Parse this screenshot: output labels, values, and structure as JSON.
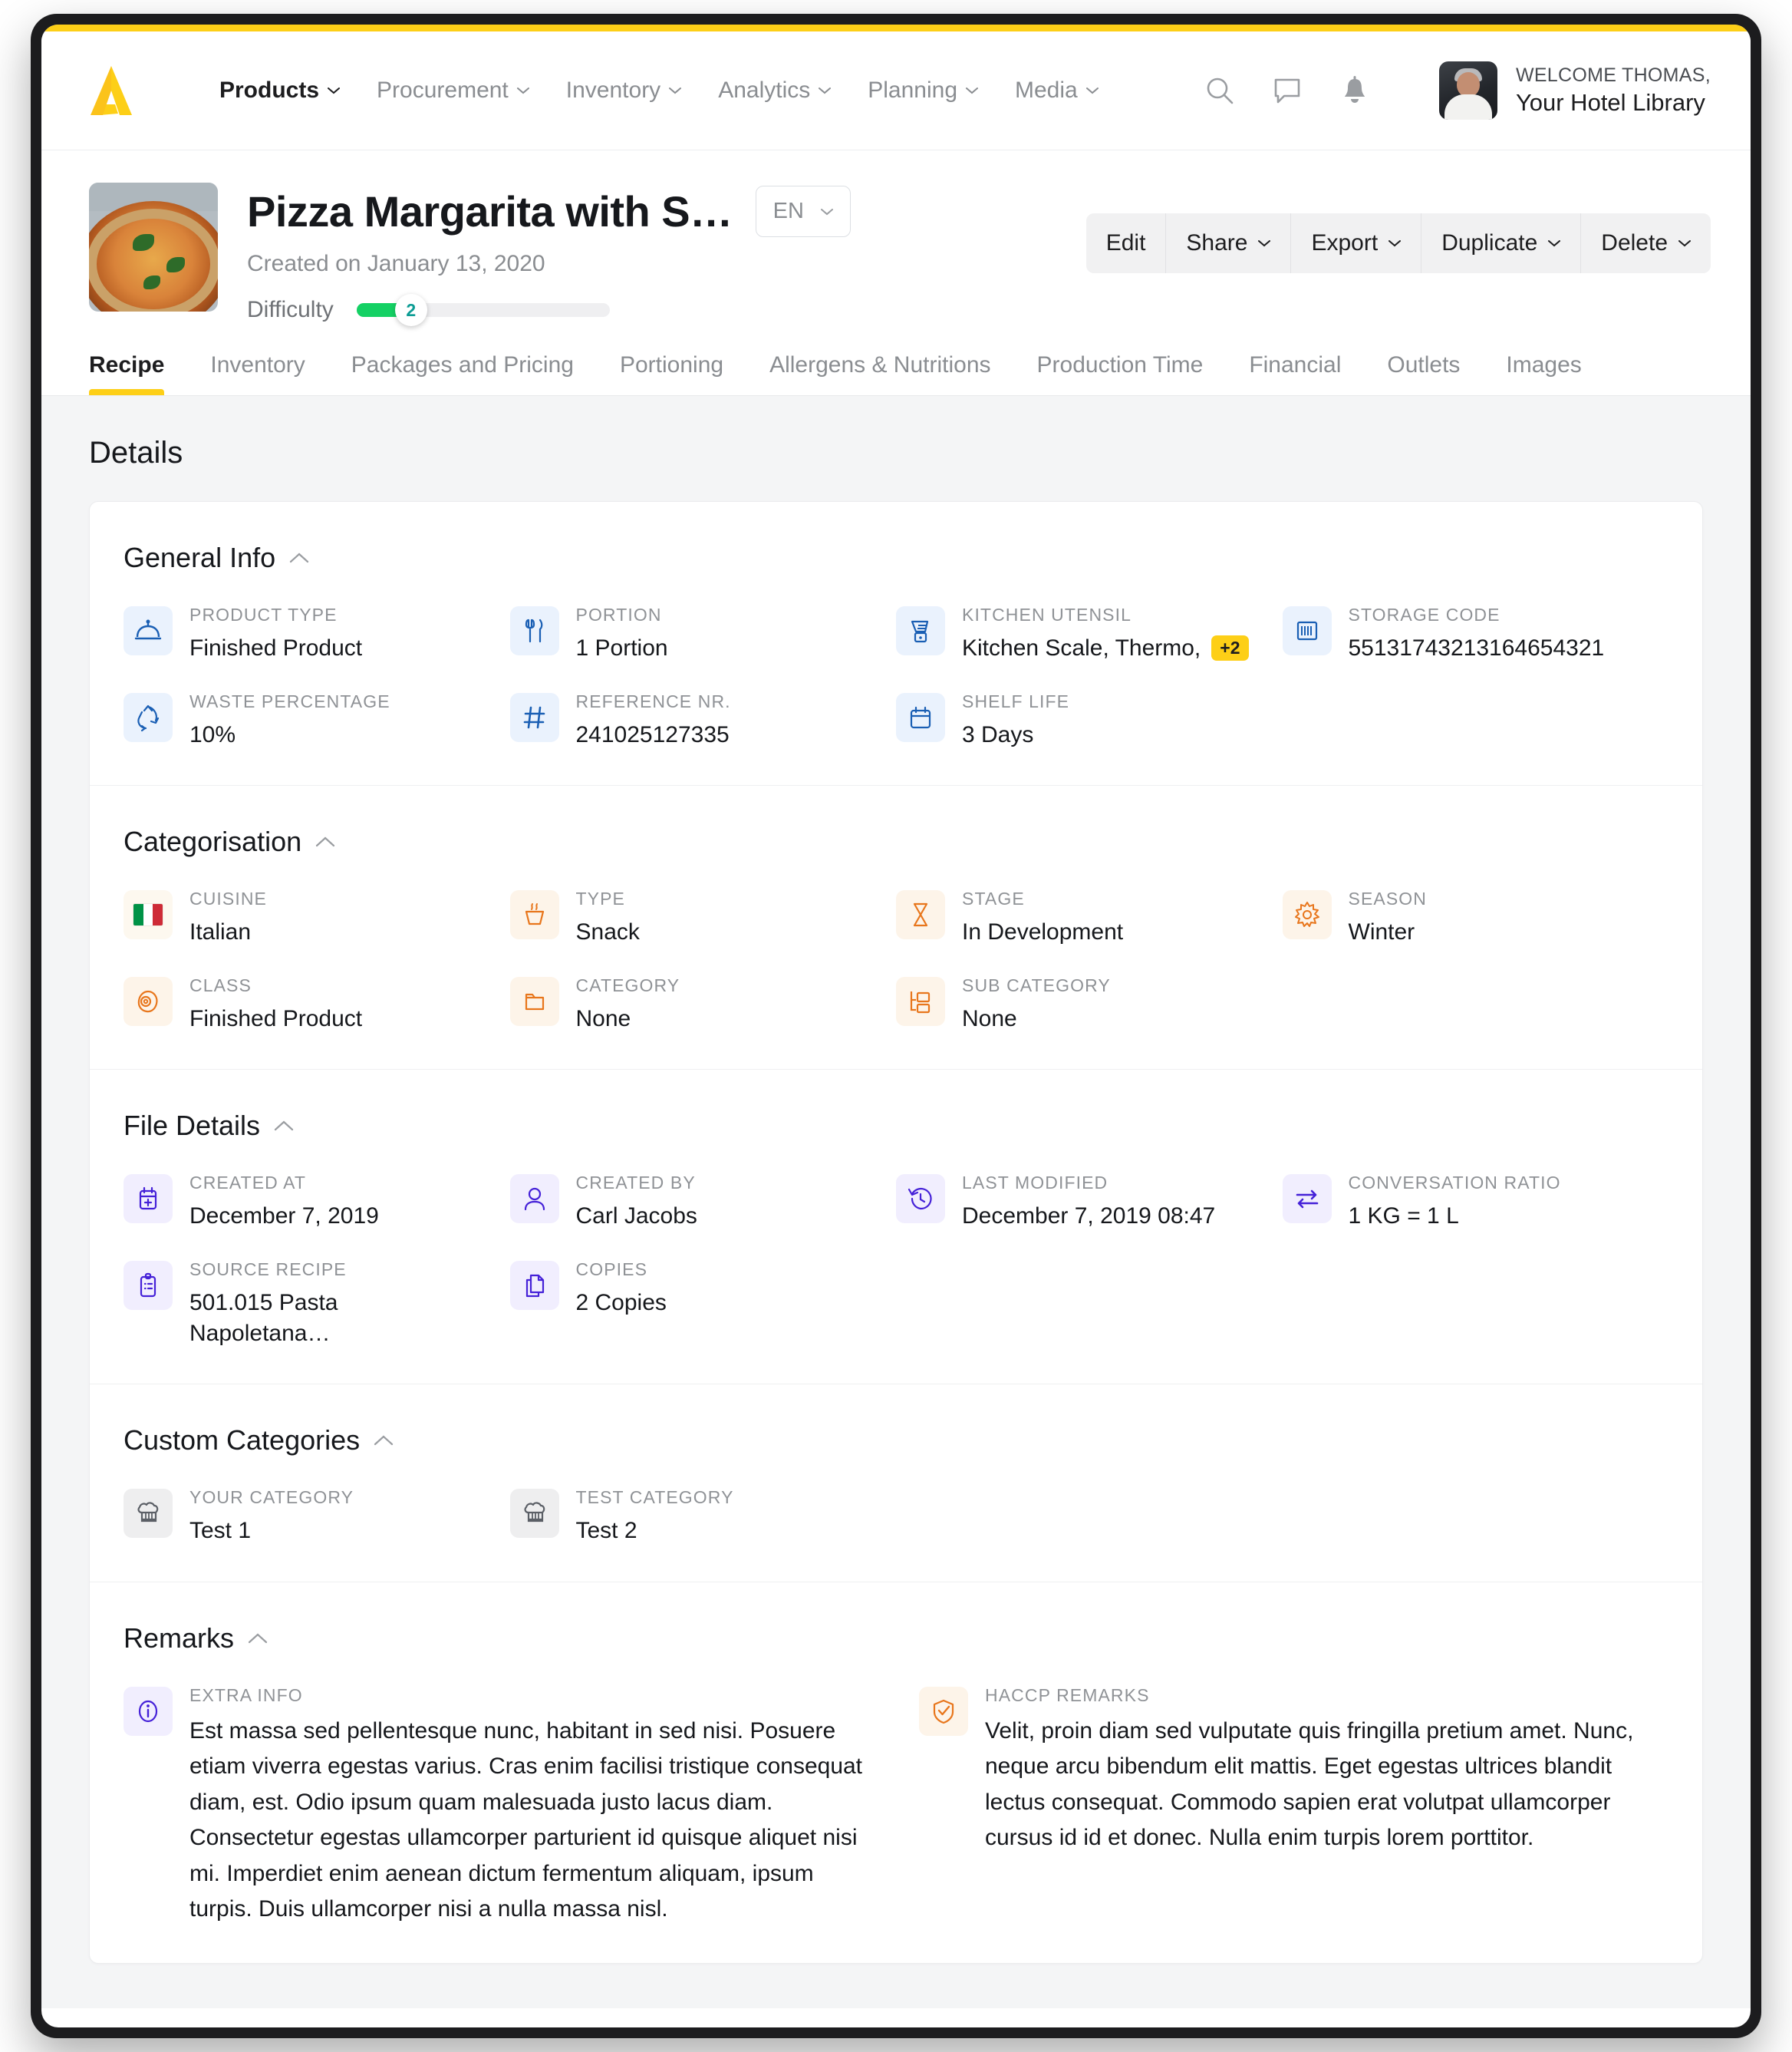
{
  "brand": {
    "accent_color": "#fdcf17",
    "logo_name": "apicbase-logo"
  },
  "topnav": {
    "menu": [
      {
        "label": "Products",
        "active": true,
        "has_caret": true
      },
      {
        "label": "Procurement",
        "active": false,
        "has_caret": true
      },
      {
        "label": "Inventory",
        "active": false,
        "has_caret": true
      },
      {
        "label": "Analytics",
        "active": false,
        "has_caret": true
      },
      {
        "label": "Planning",
        "active": false,
        "has_caret": true
      },
      {
        "label": "Media",
        "active": false,
        "has_caret": true
      }
    ],
    "icons": [
      "search-icon",
      "chat-icon",
      "bell-icon"
    ],
    "user": {
      "welcome": "WELCOME THOMAS,",
      "library": "Your Hotel Library"
    }
  },
  "product": {
    "title": "Pizza Margarita with S…",
    "created": "Created on January 13, 2020",
    "language": "EN",
    "difficulty_label": "Difficulty",
    "difficulty_value": "2",
    "difficulty_max": 10,
    "thumbnail_name": "pizza-margarita-thumbnail",
    "actions": [
      {
        "label": "Edit",
        "has_caret": false
      },
      {
        "label": "Share",
        "has_caret": true
      },
      {
        "label": "Export",
        "has_caret": true
      },
      {
        "label": "Duplicate",
        "has_caret": true
      },
      {
        "label": "Delete",
        "has_caret": true
      }
    ]
  },
  "tabs": [
    {
      "label": "Recipe",
      "active": true
    },
    {
      "label": "Inventory",
      "active": false
    },
    {
      "label": "Packages and Pricing",
      "active": false
    },
    {
      "label": "Portioning",
      "active": false
    },
    {
      "label": "Allergens & Nutritions",
      "active": false
    },
    {
      "label": "Production Time",
      "active": false
    },
    {
      "label": "Financial",
      "active": false
    },
    {
      "label": "Outlets",
      "active": false
    },
    {
      "label": "Images",
      "active": false
    }
  ],
  "details_heading": "Details",
  "sections": {
    "general_info": {
      "title": "General Info",
      "fields": [
        {
          "label": "PRODUCT TYPE",
          "value": "Finished Product",
          "icon": "cloche-icon"
        },
        {
          "label": "PORTION",
          "value": "1 Portion",
          "icon": "fork-knife-icon"
        },
        {
          "label": "KITCHEN UTENSIL",
          "value": "Kitchen Scale, Thermo,",
          "badge": "+2",
          "icon": "blender-icon"
        },
        {
          "label": "STORAGE CODE",
          "value": "55131743213164654321",
          "icon": "barcode-icon"
        },
        {
          "label": "WASTE PERCENTAGE",
          "value": "10%",
          "icon": "recycle-icon"
        },
        {
          "label": "REFERENCE NR.",
          "value": "241025127335",
          "icon": "hash-icon"
        },
        {
          "label": "SHELF LIFE",
          "value": "3 Days",
          "icon": "calendar-icon"
        }
      ]
    },
    "categorisation": {
      "title": "Categorisation",
      "fields": [
        {
          "label": "CUISINE",
          "value": "Italian",
          "icon": "italy-flag-icon"
        },
        {
          "label": "TYPE",
          "value": "Snack",
          "icon": "soup-bowl-icon"
        },
        {
          "label": "STAGE",
          "value": "In Development",
          "icon": "hourglass-icon"
        },
        {
          "label": "SEASON",
          "value": "Winter",
          "icon": "sun-icon"
        },
        {
          "label": "CLASS",
          "value": "Finished Product",
          "icon": "egg-icon"
        },
        {
          "label": "CATEGORY",
          "value": "None",
          "icon": "folder-icon"
        },
        {
          "label": "SUB CATEGORY",
          "value": "None",
          "icon": "sub-folder-tree-icon"
        }
      ]
    },
    "file_details": {
      "title": "File Details",
      "fields": [
        {
          "label": "CREATED AT",
          "value": "December 7, 2019",
          "icon": "calendar-plus-icon"
        },
        {
          "label": "CREATED BY",
          "value": "Carl Jacobs",
          "icon": "user-icon"
        },
        {
          "label": "LAST MODIFIED",
          "value": "December 7, 2019 08:47",
          "icon": "history-clock-icon"
        },
        {
          "label": "CONVERSATION RATIO",
          "value": "1 KG = 1 L",
          "icon": "swap-arrows-icon"
        },
        {
          "label": "SOURCE RECIPE",
          "value": "501.015 Pasta Napoletana…",
          "icon": "clipboard-list-icon"
        },
        {
          "label": "COPIES",
          "value": "2 Copies",
          "icon": "copy-icon"
        }
      ]
    },
    "custom_categories": {
      "title": "Custom Categories",
      "fields": [
        {
          "label": "YOUR CATEGORY",
          "value": "Test 1",
          "icon": "chef-hat-icon"
        },
        {
          "label": "TEST CATEGORY",
          "value": "Test 2",
          "icon": "chef-hat-icon"
        }
      ]
    },
    "remarks": {
      "title": "Remarks",
      "fields": [
        {
          "label": "EXTRA INFO",
          "icon": "info-icon",
          "value": "Est massa sed pellentesque nunc, habitant in sed nisi. Posuere etiam viverra egestas varius. Cras enim facilisi tristique consequat diam, est. Odio ipsum quam malesuada justo lacus diam. Consectetur egestas ullamcorper parturient id quisque aliquet nisi mi. Imperdiet enim aenean dictum fermentum aliquam, ipsum turpis. Duis ullamcorper nisi a nulla massa nisl."
        },
        {
          "label": "HACCP REMARKS",
          "icon": "shield-check-icon",
          "value": "Velit, proin diam sed vulputate quis fringilla pretium amet. Nunc, neque arcu bibendum elit mattis. Eget egestas ultrices blandit lectus consequat. Commodo sapien erat volutpat ullamcorper cursus id id et donec. Nulla enim turpis lorem porttitor."
        }
      ]
    }
  }
}
